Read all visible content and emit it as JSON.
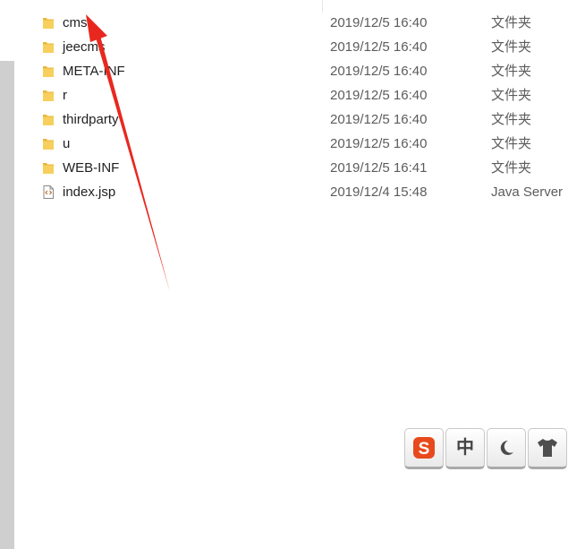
{
  "files": [
    {
      "name": "cms",
      "date": "2019/12/5 16:40",
      "type": "文件夹",
      "icon": "folder-icon"
    },
    {
      "name": "jeecms",
      "date": "2019/12/5 16:40",
      "type": "文件夹",
      "icon": "folder-icon"
    },
    {
      "name": "META-INF",
      "date": "2019/12/5 16:40",
      "type": "文件夹",
      "icon": "folder-icon"
    },
    {
      "name": "r",
      "date": "2019/12/5 16:40",
      "type": "文件夹",
      "icon": "folder-icon"
    },
    {
      "name": "thirdparty",
      "date": "2019/12/5 16:40",
      "type": "文件夹",
      "icon": "folder-icon"
    },
    {
      "name": "u",
      "date": "2019/12/5 16:40",
      "type": "文件夹",
      "icon": "folder-icon"
    },
    {
      "name": "WEB-INF",
      "date": "2019/12/5 16:41",
      "type": "文件夹",
      "icon": "folder-icon"
    },
    {
      "name": "index.jsp",
      "date": "2019/12/4 15:48",
      "type": "Java Server",
      "icon": "jsp-file-icon"
    }
  ],
  "ime_toolbar": {
    "buttons": [
      {
        "icon": "sogou-logo-icon",
        "glyph": "S"
      },
      {
        "icon": "chinese-mode-icon",
        "glyph": "中"
      },
      {
        "icon": "moon-icon",
        "glyph": "☾"
      },
      {
        "icon": "skin-shirt-icon",
        "glyph": "👕"
      }
    ]
  },
  "colors": {
    "folder": "#f3c44a",
    "annotation_arrow": "#e8281f",
    "sogou_red": "#e84a1c"
  }
}
